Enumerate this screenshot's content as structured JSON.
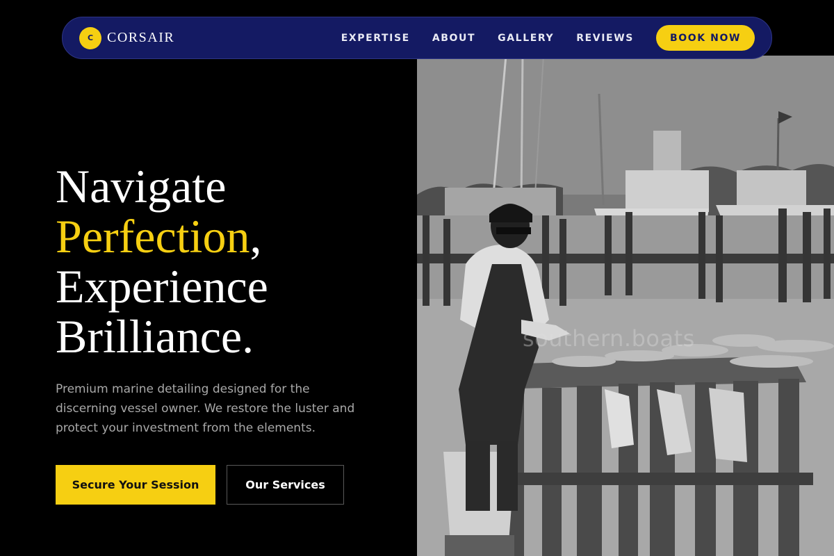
{
  "nav": {
    "logo_letter": "C",
    "brand": "CORSAIR",
    "links": [
      "EXPERTISE",
      "ABOUT",
      "GALLERY",
      "REVIEWS"
    ],
    "cta": "BOOK NOW"
  },
  "hero": {
    "headline_line1": "Navigate",
    "headline_accent": "Perfection",
    "headline_comma": ",",
    "headline_line3": "Experience",
    "headline_line4": "Brilliance.",
    "subtitle": "Premium marine detailing designed for the discerning vessel owner. We restore the luster and protect your investment from the elements.",
    "primary_button": "Secure Your Session",
    "secondary_button": "Our Services"
  },
  "image": {
    "watermark": "southern.boats"
  },
  "colors": {
    "background": "#000000",
    "nav_bg": "#141a63",
    "accent": "#f6cf12",
    "text": "#ffffff",
    "muted": "#a9a9a9"
  }
}
